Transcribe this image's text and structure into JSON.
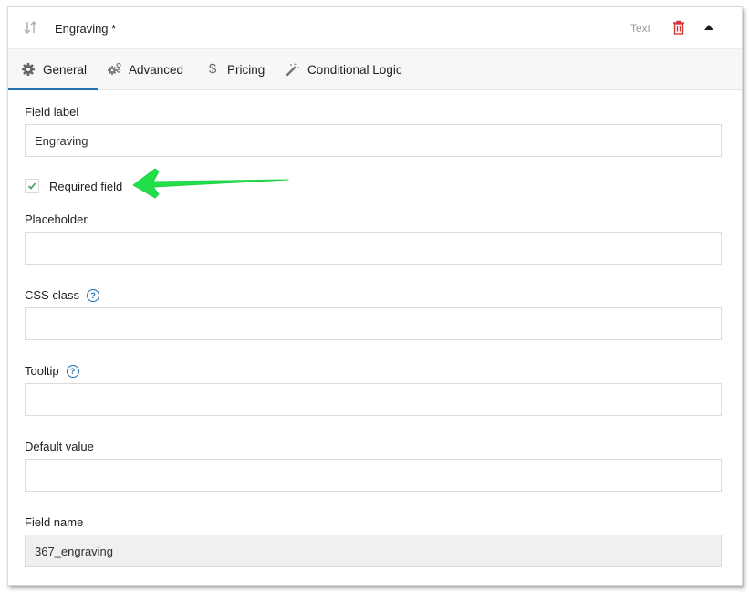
{
  "header": {
    "title": "Engraving *",
    "field_type": "Text",
    "sort_icon": "sort-arrows-icon",
    "delete_icon": "trash-icon",
    "collapse_icon": "caret-up-icon"
  },
  "tabs": [
    {
      "label": "General",
      "icon": "gear-icon",
      "active": true
    },
    {
      "label": "Advanced",
      "icon": "gears-icon",
      "active": false
    },
    {
      "label": "Pricing",
      "icon": "dollar-icon",
      "active": false
    },
    {
      "label": "Conditional Logic",
      "icon": "magic-wand-icon",
      "active": false
    }
  ],
  "form": {
    "field_label": {
      "label": "Field label",
      "value": "Engraving"
    },
    "required": {
      "label": "Required field",
      "checked": true
    },
    "placeholder": {
      "label": "Placeholder",
      "value": ""
    },
    "css_class": {
      "label": "CSS class",
      "value": "",
      "help": "?"
    },
    "tooltip": {
      "label": "Tooltip",
      "value": "",
      "help": "?"
    },
    "default_value": {
      "label": "Default value",
      "value": ""
    },
    "field_name": {
      "label": "Field name",
      "value": "367_engraving"
    }
  },
  "annotation": {
    "type": "arrow",
    "color": "#22e04a",
    "points_to": "required-field-checkbox"
  },
  "colors": {
    "accent": "#2271b1",
    "danger": "#d63638",
    "annotation": "#22e04a"
  }
}
